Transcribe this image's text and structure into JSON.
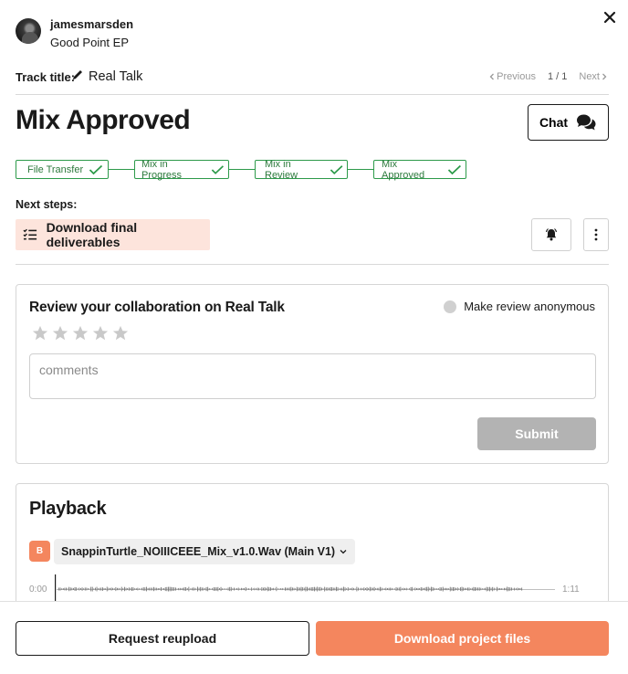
{
  "header": {
    "username": "jamesmarsden",
    "project_name": "Good Point EP"
  },
  "track": {
    "label": "Track title:",
    "name": "Real Talk",
    "previous_label": "Previous",
    "page_indicator": "1 / 1",
    "next_label": "Next"
  },
  "status": {
    "title": "Mix Approved",
    "chat_label": "Chat"
  },
  "steps": [
    {
      "label": "File Transfer",
      "done": true
    },
    {
      "label": "Mix in Progress",
      "done": true
    },
    {
      "label": "Mix in Review",
      "done": true
    },
    {
      "label": "Mix Approved",
      "done": true
    }
  ],
  "next_steps": {
    "label": "Next steps:",
    "action": "Download final deliverables"
  },
  "review": {
    "title": "Review your collaboration on Real Talk",
    "anonymous_label": "Make review anonymous",
    "rating": 0,
    "rating_max": 5,
    "comments_placeholder": "comments",
    "submit_label": "Submit"
  },
  "playback": {
    "title": "Playback",
    "file_badge": "B",
    "file_name": "SnappinTurtle_NOIIICEEE_Mix_v1.0.Wav (Main V1)",
    "time_start": "0:00",
    "time_end": "1:11"
  },
  "footer": {
    "reupload_label": "Request reupload",
    "download_label": "Download project files"
  },
  "colors": {
    "accent": "#f4865e",
    "step_green": "#2d9a4a",
    "next_step_bg": "#fde4dc",
    "disabled": "#b3b3b3"
  }
}
